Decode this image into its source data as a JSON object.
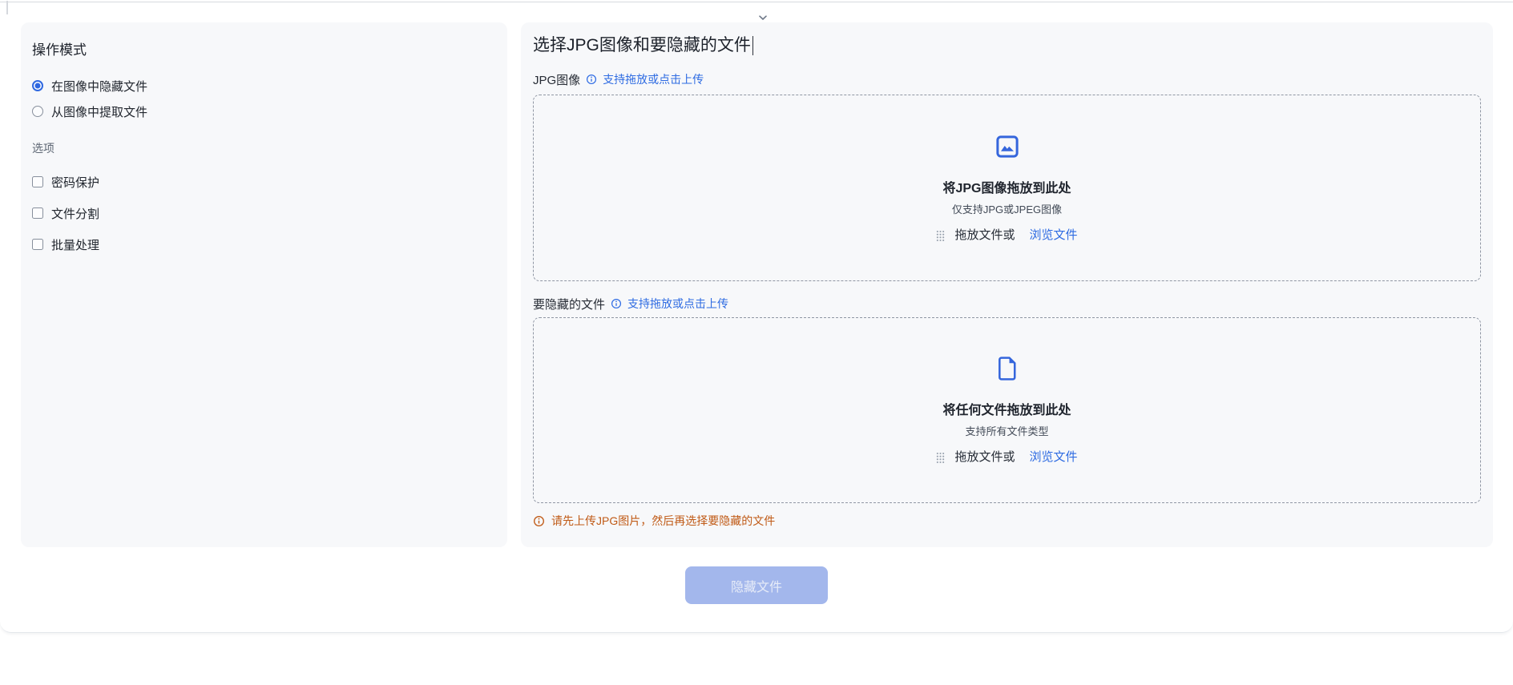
{
  "header": {
    "collapse_icon": "chevron-down"
  },
  "sidebar": {
    "mode_heading": "操作模式",
    "modes": [
      {
        "label": "在图像中隐藏文件",
        "selected": true
      },
      {
        "label": "从图像中提取文件",
        "selected": false
      }
    ],
    "options_heading": "选项",
    "options": [
      {
        "label": "密码保护",
        "checked": false
      },
      {
        "label": "文件分割",
        "checked": false
      },
      {
        "label": "批量处理",
        "checked": false
      }
    ]
  },
  "main": {
    "title": "选择JPG图像和要隐藏的文件",
    "jpg_section": {
      "label": "JPG图像",
      "info_icon": "info-circle",
      "hint": "支持拖放或点击上传",
      "dropzone": {
        "icon": "image",
        "title": "将JPG图像拖放到此处",
        "subtitle": "仅支持JPG或JPEG图像",
        "drag_handle_icon": "drag-dots",
        "drag_text": "拖放文件或",
        "browse_label": "浏览文件"
      }
    },
    "file_section": {
      "label": "要隐藏的文件",
      "info_icon": "info-circle",
      "hint": "支持拖放或点击上传",
      "dropzone": {
        "icon": "file",
        "title": "将任何文件拖放到此处",
        "subtitle": "支持所有文件类型",
        "drag_handle_icon": "drag-dots",
        "drag_text": "拖放文件或",
        "browse_label": "浏览文件"
      }
    },
    "warning": {
      "icon": "info-circle",
      "text": "请先上传JPG图片，然后再选择要隐藏的文件"
    }
  },
  "footer": {
    "submit_label": "隐藏文件",
    "submit_disabled": true
  },
  "colors": {
    "accent_blue": "#2f6ce4",
    "icon_blue": "#3566dc",
    "panel_bg": "#f7f8fa",
    "dashed_border": "#8f96a3",
    "warning_orange": "#c05a16",
    "disabled_button_bg": "#a3b7ec"
  }
}
